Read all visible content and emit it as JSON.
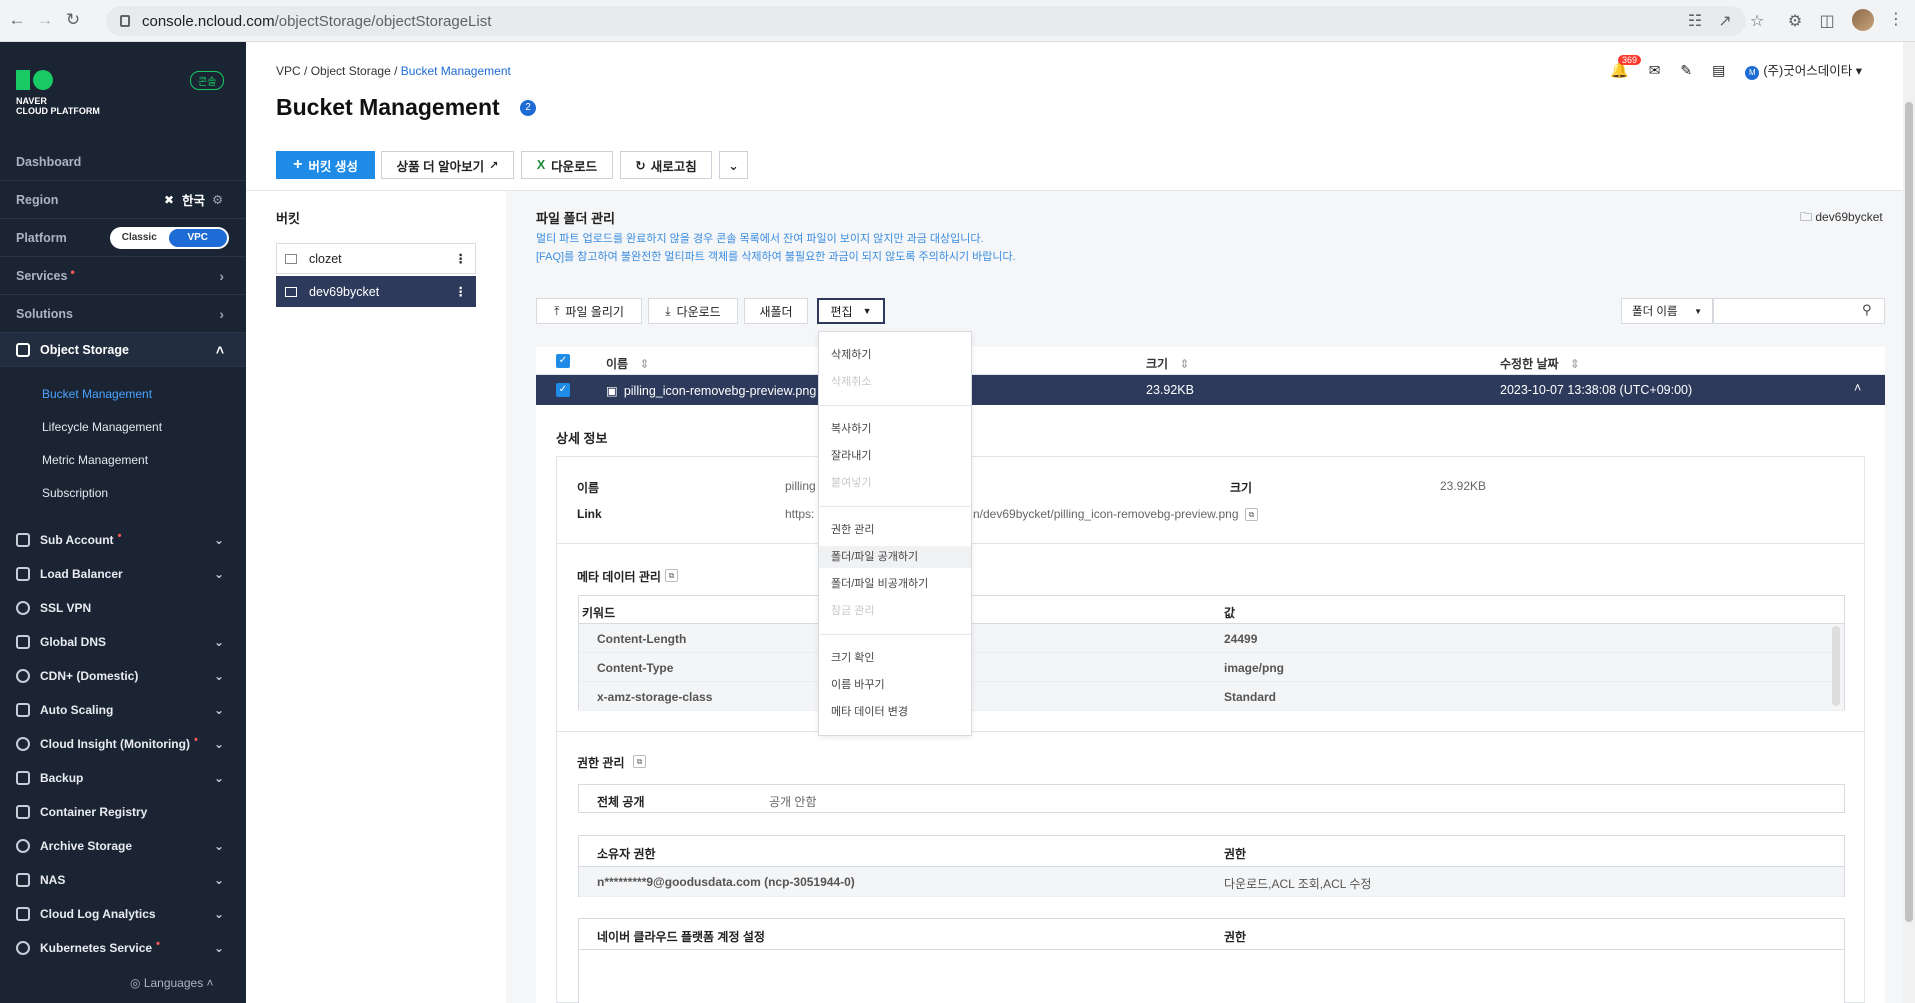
{
  "browser": {
    "url_domain": "console.ncloud.com",
    "url_path": "/objectStorage/objectStorageList"
  },
  "sidebar": {
    "logo_line1": "NAVER",
    "logo_line2": "CLOUD PLATFORM",
    "console_badge": "콘솔",
    "dashboard": "Dashboard",
    "region_label": "Region",
    "region_value": "한국",
    "platform_label": "Platform",
    "platform_options": [
      "Classic",
      "VPC"
    ],
    "platform_selected": "VPC",
    "services": "Services",
    "solutions": "Solutions",
    "object_storage": "Object Storage",
    "sub_items": [
      "Bucket Management",
      "Lifecycle Management",
      "Metric Management",
      "Subscription"
    ],
    "service_items": [
      {
        "label": "Sub Account",
        "star": true
      },
      {
        "label": "Load Balancer",
        "star": false
      },
      {
        "label": "SSL VPN",
        "star": false
      },
      {
        "label": "Global DNS",
        "star": false
      },
      {
        "label": "CDN+ (Domestic)",
        "star": false
      },
      {
        "label": "Auto Scaling",
        "star": false
      },
      {
        "label": "Cloud Insight (Monitoring)",
        "star": true
      },
      {
        "label": "Backup",
        "star": false
      },
      {
        "label": "Container Registry",
        "star": false
      },
      {
        "label": "Archive Storage",
        "star": false
      },
      {
        "label": "NAS",
        "star": false
      },
      {
        "label": "Cloud Log Analytics",
        "star": false
      },
      {
        "label": "Kubernetes Service",
        "star": true
      }
    ],
    "languages": "Languages"
  },
  "header": {
    "breadcrumb": [
      "VPC",
      "Object Storage",
      "Bucket Management"
    ],
    "title": "Bucket Management",
    "title_badge": "2",
    "notification_count": "369",
    "user_initial": "M",
    "user_name": "(주)굿어스데이타"
  },
  "toolbar": {
    "create": "버킷 생성",
    "learn_more": "상품 더 알아보기",
    "download": "다운로드",
    "refresh": "새로고침"
  },
  "buckets": {
    "title": "버킷",
    "items": [
      "clozet",
      "dev69bycket"
    ],
    "selected": "dev69bycket"
  },
  "file_panel": {
    "title": "파일 폴더 관리",
    "info1": "멀티 파트 업로드를 완료하지 않을 경우 콘솔 목록에서 잔여 파일이 보이지 않지만 과금 대상입니다.",
    "info2": "[FAQ]를 참고하여 불완전한 멀티파트 객체를 삭제하여 불필요한 과금이 되지 않도록 주의하시기 바랍니다.",
    "current_folder": "dev69bycket",
    "upload": "파일 올리기",
    "download": "다운로드",
    "new_folder": "새폴더",
    "edit": "편집",
    "search_select": "폴더 이름",
    "search_placeholder": ""
  },
  "table": {
    "columns": [
      "이름",
      "크기",
      "수정한 날짜"
    ],
    "row": {
      "name": "pilling_icon-removebg-preview.png",
      "size": "23.92KB",
      "modified": "2023-10-07 13:38:08 (UTC+09:00)"
    }
  },
  "detail": {
    "title": "상세 정보",
    "name_label": "이름",
    "name_value": "pilling",
    "size_label": "크기",
    "size_value": "23.92KB",
    "link_label": "Link",
    "link_value_start": "https:",
    "link_value_end": "n/dev69bycket/pilling_icon-removebg-preview.png",
    "meta_title": "메타 데이터 관리",
    "meta_columns": [
      "키워드",
      "값"
    ],
    "meta_rows": [
      {
        "key": "Content-Length",
        "value": "24499"
      },
      {
        "key": "Content-Type",
        "value": "image/png"
      },
      {
        "key": "x-amz-storage-class",
        "value": "Standard"
      }
    ],
    "perm_title": "권한 관리",
    "public_label": "전체 공개",
    "public_value": "공개 안함",
    "owner_columns": [
      "소유자 권한",
      "권한"
    ],
    "owner_row": {
      "owner": "n*********9@goodusdata.com (ncp-3051944-0)",
      "perm": "다운로드,ACL 조회,ACL 수정"
    },
    "ncp_columns": [
      "네이버 클라우드 플랫폼 계정 설정",
      "권한"
    ]
  },
  "dropdown": {
    "items": [
      {
        "label": "삭제하기",
        "disabled": false
      },
      {
        "label": "삭제취소",
        "disabled": true
      },
      {
        "label": "복사하기",
        "disabled": false
      },
      {
        "label": "잘라내기",
        "disabled": false
      },
      {
        "label": "붙여넣기",
        "disabled": true
      },
      {
        "label": "권한 관리",
        "disabled": false
      },
      {
        "label": "폴더/파일 공개하기",
        "disabled": false
      },
      {
        "label": "폴더/파일 비공개하기",
        "disabled": false
      },
      {
        "label": "잠금 관리",
        "disabled": true
      },
      {
        "label": "크기 확인",
        "disabled": false
      },
      {
        "label": "이름 바꾸기",
        "disabled": false
      },
      {
        "label": "메타 데이터 변경",
        "disabled": false
      }
    ],
    "hovered": "폴더/파일 공개하기"
  },
  "colors": {
    "accent": "#1e8be6",
    "sidebar": "#1b2433",
    "selected_row": "#2d3a5c",
    "info_text": "#3a8de0"
  }
}
